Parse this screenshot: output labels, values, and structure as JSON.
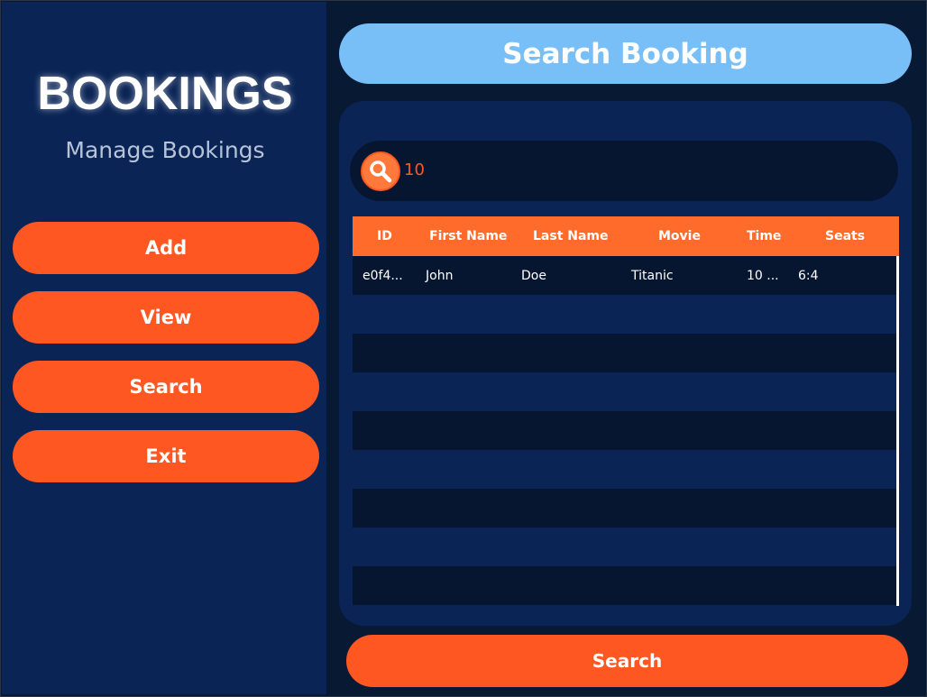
{
  "sidebar": {
    "title": "BOOKINGS",
    "subtitle": "Manage Bookings",
    "buttons": [
      {
        "label": "Add"
      },
      {
        "label": "View"
      },
      {
        "label": "Search"
      },
      {
        "label": "Exit"
      }
    ]
  },
  "main": {
    "title": "Search Booking",
    "search": {
      "icon": "search-icon",
      "value": "10"
    },
    "table": {
      "columns": [
        "ID",
        "First Name",
        "Last Name",
        "Movie",
        "Time",
        "Seats"
      ],
      "rows": [
        [
          "e0f4...",
          "John",
          "Doe",
          "Titanic",
          "10 ...",
          "6:4"
        ]
      ]
    },
    "search_button": "Search"
  },
  "colors": {
    "accent": "#ff5722",
    "header_orange": "#ff6b2b",
    "title_blue": "#79bff7",
    "sidebar_bg": "#0a2456",
    "main_bg": "#081a33"
  }
}
